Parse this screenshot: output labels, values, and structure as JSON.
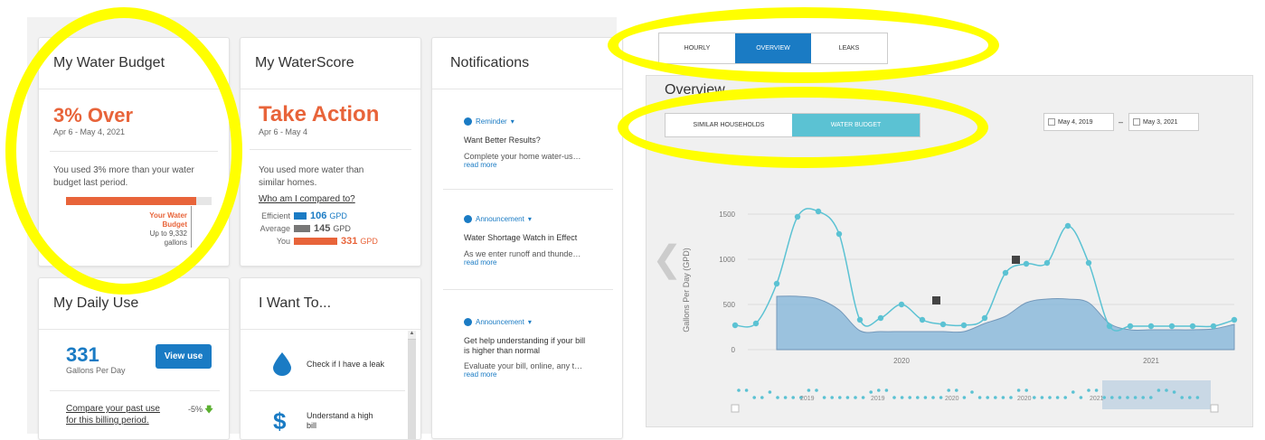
{
  "budget": {
    "title": "My Water Budget",
    "status": "3% Over",
    "dates": "Apr 6 - May 4, 2021",
    "text": "You used 3% more than your water budget last period.",
    "bar_used_percent": 103,
    "label_line1": "Your Water",
    "label_line2": "Budget",
    "label_line3": "Up to 9,332",
    "label_line4": "gallons"
  },
  "score": {
    "title": "My WaterScore",
    "status": "Take Action",
    "dates": "Apr 6 - May 4",
    "text": "You used more water than similar homes.",
    "link": "Who am I compared to?",
    "rows": [
      {
        "label": "Efficient",
        "value": "106",
        "unit": "GPD"
      },
      {
        "label": "Average",
        "value": "145",
        "unit": "GPD"
      },
      {
        "label": "You",
        "value": "331",
        "unit": "GPD"
      }
    ]
  },
  "notifications": {
    "title": "Notifications",
    "items": [
      {
        "type": "Reminder",
        "title": "Want Better Results?",
        "text": "Complete your home water-us…",
        "more": "read more"
      },
      {
        "type": "Announcement",
        "title": "Water Shortage Watch in Effect",
        "text": "As we enter runoff and thunde…",
        "more": "read more"
      },
      {
        "type": "Announcement",
        "title": "Get help understanding if your bill is higher than normal",
        "text": "Evaluate your bill, online, any t…",
        "more": "read more"
      }
    ]
  },
  "daily": {
    "title": "My Daily Use",
    "value": "331",
    "unit": "Gallons Per Day",
    "button": "View use",
    "compare_line1": "Compare your past use",
    "compare_line2": "for this billing period.",
    "change": "-5%"
  },
  "iwant": {
    "title": "I Want To...",
    "items": [
      {
        "label": "Check if I have a leak",
        "icon": "water-drop-icon"
      },
      {
        "label_line1": "Understand a high",
        "label_line2": "bill",
        "icon": "dollar-icon"
      }
    ]
  },
  "tabs": {
    "hourly": "HOURLY",
    "overview": "OVERVIEW",
    "leaks": "LEAKS"
  },
  "overview": {
    "title": "Overview",
    "sub_tabs": {
      "similar": "SIMILAR HOUSEHOLDS",
      "budget": "WATER BUDGET"
    },
    "date_from": "May 4, 2019",
    "date_sep": "–",
    "date_to": "May 3, 2021"
  },
  "colors": {
    "accent": "#1a7bc4",
    "orange": "#e8643a",
    "line": "#5bc2d3",
    "area": "#7fb3d8",
    "highlight": "#ffff00"
  },
  "chart_data": {
    "type": "line",
    "ylabel": "Gallons Per Day (GPD)",
    "yticks": [
      "1500",
      "1000",
      "500",
      "0"
    ],
    "xticks": [
      "2020",
      "2021"
    ],
    "ylim": [
      0,
      1650
    ],
    "series": [
      {
        "values": [
          270,
          290,
          730,
          1470,
          1530,
          1280,
          330,
          350,
          500,
          330,
          280,
          270,
          350,
          850,
          950,
          960,
          1370,
          960,
          260,
          260,
          260,
          260,
          260,
          260,
          330
        ]
      },
      {
        "type": "area",
        "values": [
          null,
          null,
          590,
          590,
          560,
          440,
          210,
          200,
          200,
          200,
          200,
          200,
          290,
          370,
          520,
          560,
          560,
          520,
          290,
          220,
          220,
          220,
          220,
          230,
          280
        ]
      }
    ],
    "annotation_icons": 2,
    "navigator_labels": [
      "2019",
      "2019",
      "2020",
      "2020",
      "2021"
    ]
  }
}
